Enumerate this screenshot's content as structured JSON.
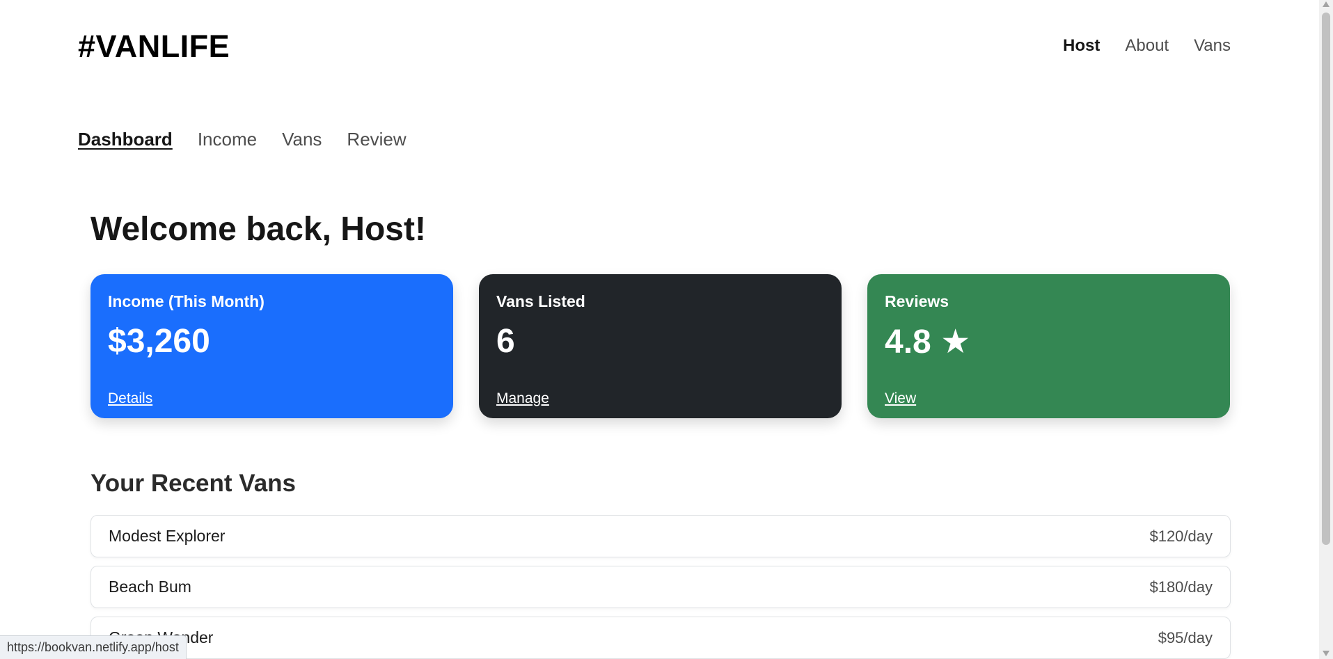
{
  "header": {
    "logo": "#VANLIFE",
    "nav": [
      {
        "label": "Host",
        "active": true
      },
      {
        "label": "About",
        "active": false
      },
      {
        "label": "Vans",
        "active": false
      }
    ]
  },
  "host_nav": [
    {
      "label": "Dashboard",
      "active": true
    },
    {
      "label": "Income",
      "active": false
    },
    {
      "label": "Vans",
      "active": false
    },
    {
      "label": "Review",
      "active": false
    }
  ],
  "welcome": "Welcome back, Host!",
  "cards": [
    {
      "title": "Income (This Month)",
      "value": "$3,260",
      "link": "Details",
      "color": "#1a6efd"
    },
    {
      "title": "Vans Listed",
      "value": "6",
      "link": "Manage",
      "color": "#212529"
    },
    {
      "title": "Reviews",
      "value": "4.8 ★",
      "link": "View",
      "color": "#348753"
    }
  ],
  "recent": {
    "title": "Your Recent Vans",
    "vans": [
      {
        "name": "Modest Explorer",
        "price": "$120/day"
      },
      {
        "name": "Beach Bum",
        "price": "$180/day"
      },
      {
        "name": "Green Wonder",
        "price": "$95/day"
      }
    ]
  },
  "status_url": "https://bookvan.netlify.app/host"
}
